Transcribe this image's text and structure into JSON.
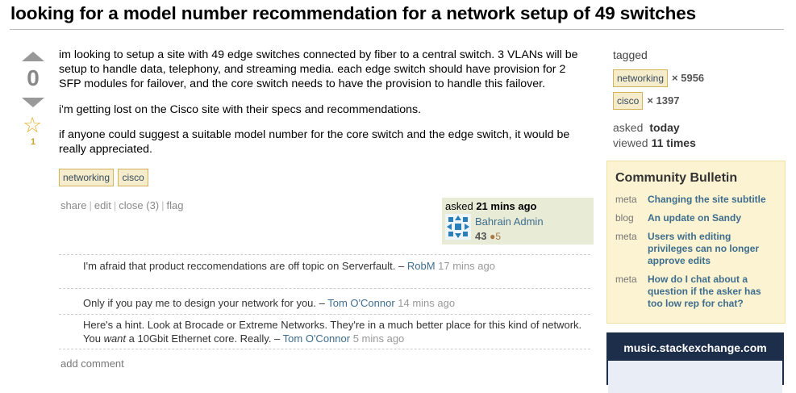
{
  "question": {
    "title": "looking for a model number recommendation for a network setup of 49 switches",
    "votes": "0",
    "favorites": "1",
    "body": [
      "im looking to setup a site with 49 edge switches connected by fiber to a central switch. 3 VLANs will be setup to handle data, telephony, and streaming media. each edge switch should have provision for 2 SFP modules for failover, and the core switch needs to have the provision to handle this failover.",
      "i'm getting lost on the Cisco site with their specs and recommendations.",
      "if anyone could suggest a suitable model number for the core switch and the edge switch, it would be really appreciated."
    ],
    "tags": [
      "networking",
      "cisco"
    ],
    "menu": {
      "share": "share",
      "edit": "edit",
      "close": "close (3)",
      "flag": "flag"
    },
    "signature": {
      "asked_label": "asked",
      "asked_time": "21 mins ago",
      "user_name": "Bahrain Admin",
      "reputation": "43",
      "badge": "●5"
    }
  },
  "comments": [
    {
      "text": "I'm afraid that product reccomendations are off topic on Serverfault. – ",
      "user": "RobM",
      "time": " 17 mins ago"
    },
    {
      "text": "Only if you pay me to design your network for you. – ",
      "user": "Tom O'Connor",
      "time": " 14 mins ago"
    },
    {
      "text_before": "Here's a hint. Look at Brocade or Extreme Networks. They're in a much better place for this kind of network. You ",
      "emph": "want",
      "text_after": " a 10Gbit Ethernet core. Really. – ",
      "user": "Tom O'Connor",
      "time": " 5 mins ago"
    }
  ],
  "add_comment": "add comment",
  "sidebar": {
    "tagged_label": "tagged",
    "tags": [
      {
        "name": "networking",
        "count": "× 5956"
      },
      {
        "name": "cisco",
        "count": "× 1397"
      }
    ],
    "asked_label": "asked",
    "asked_value": "today",
    "viewed_label": "viewed",
    "viewed_value": "11 times",
    "bulletin": {
      "title": "Community Bulletin",
      "items": [
        {
          "kind": "meta",
          "text": "Changing the site subtitle"
        },
        {
          "kind": "blog",
          "text": "An update on Sandy"
        },
        {
          "kind": "meta",
          "text": "Users with editing privileges can no longer approve edits"
        },
        {
          "kind": "meta",
          "text": "How do I chat about a question if the asker has too low rep for chat?"
        }
      ]
    },
    "site_ad": "music.stackexchange.com"
  },
  "colors": {
    "link": "#3e6d8e",
    "tag_bg": "#f5eccb",
    "bulletin_bg": "#fbf3d1",
    "ad_bg": "#1d2e4a"
  }
}
